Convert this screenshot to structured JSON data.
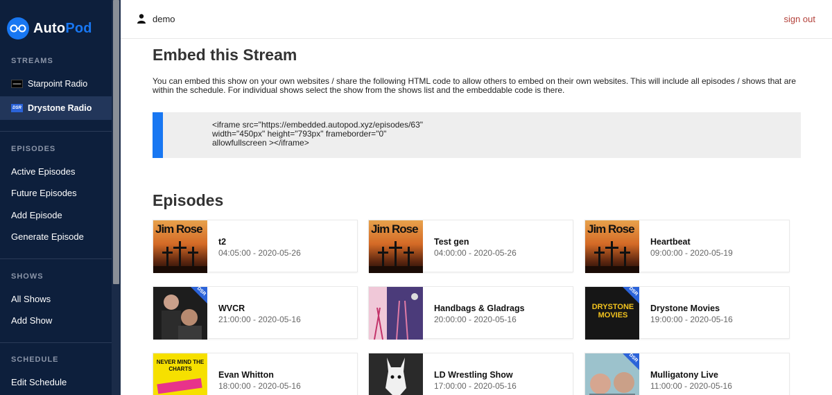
{
  "brand": {
    "name_a": "Auto",
    "name_b": "Pod"
  },
  "sidebar": {
    "streams_header": "STREAMS",
    "streams": [
      {
        "label": "Starpoint Radio",
        "icon": "starpoint-logo-icon"
      },
      {
        "label": "Drystone Radio",
        "icon": "dsr-logo-icon",
        "active": true
      }
    ],
    "episodes_header": "EPISODES",
    "episodes": [
      "Active Episodes",
      "Future Episodes",
      "Add Episode",
      "Generate Episode"
    ],
    "shows_header": "SHOWS",
    "shows": [
      "All Shows",
      "Add Show"
    ],
    "schedule_header": "SCHEDULE",
    "schedule": [
      "Edit Schedule"
    ]
  },
  "topbar": {
    "username": "demo",
    "signout": "sign out"
  },
  "embed": {
    "title": "Embed this Stream",
    "description": "You can embed this show on your own websites / share the following HTML code to allow others to embed on their own websites. This will include all episodes / shows that are within the schedule. For individual shows select the show from the shows list and the embeddable code is there.",
    "code": "<iframe src=\"https://embedded.autopod.xyz/episodes/63\"\nwidth=\"450px\" height=\"793px\" frameborder=\"0\"\nallowfullscreen ></iframe>"
  },
  "episodes": {
    "title": "Episodes",
    "items": [
      {
        "title": "t2",
        "time": "04:05:00 - 2020-05-26",
        "thumb_text": "Jim Rose"
      },
      {
        "title": "Test gen",
        "time": "04:00:00 - 2020-05-26",
        "thumb_text": "Jim Rose"
      },
      {
        "title": "Heartbeat",
        "time": "09:00:00 - 2020-05-19",
        "thumb_text": "Jim Rose"
      },
      {
        "title": "WVCR",
        "time": "21:00:00 - 2020-05-16",
        "thumb_text": "DSR"
      },
      {
        "title": "Handbags & Gladrags",
        "time": "20:00:00 - 2020-05-16",
        "thumb_text": ""
      },
      {
        "title": "Drystone Movies",
        "time": "19:00:00 - 2020-05-16",
        "thumb_text": "DRYSTONE MOVIES"
      },
      {
        "title": "Evan Whitton",
        "time": "18:00:00 - 2020-05-16",
        "thumb_text": "NEVER MIND THE CHARTS"
      },
      {
        "title": "LD Wrestling Show",
        "time": "17:00:00 - 2020-05-16",
        "thumb_text": ""
      },
      {
        "title": "Mulligatony Live",
        "time": "11:00:00 - 2020-05-16",
        "thumb_text": "DSR"
      }
    ]
  },
  "colors": {
    "sidebar_bg": "#0d1f3c",
    "accent": "#1877f2",
    "signout": "#b3413a",
    "code_bg": "#eeeeee"
  }
}
